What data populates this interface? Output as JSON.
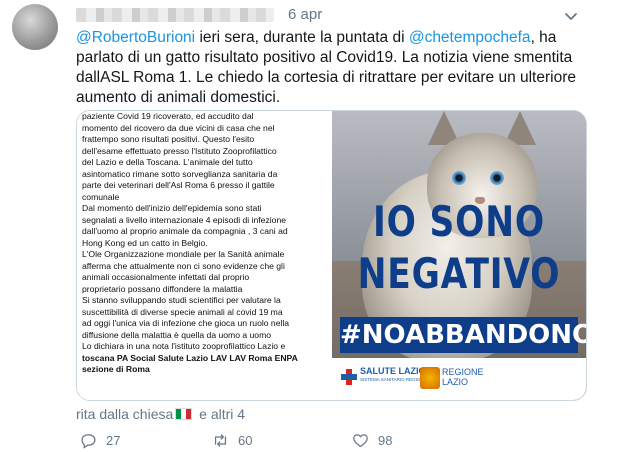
{
  "tweet": {
    "time": "6 apr",
    "text_parts": {
      "mention1": "@RobertoBurioni",
      "text1": " ieri sera, durante la puntata di ",
      "mention2": "@chetempochefa",
      "text2": ", ha parlato di un gatto risultato positivo al Covid19. La notizia viene smentita dallASL Roma 1. Le chiedo la cortesia di ritrattare per evitare un ulteriore aumento di animali domestici."
    },
    "retweet_by": "rita dalla chiesa",
    "retweet_others": " e altri 4",
    "actions": {
      "replies": "27",
      "retweets": "60",
      "likes": "98"
    }
  },
  "media": {
    "document_lines": [
      {
        "text": "paziente Covid 19 ricoverato, ed accudito dal",
        "bold": false
      },
      {
        "text": "momento del ricovero da due vicini di casa che nel",
        "bold": false
      },
      {
        "text": "frattempo sono risultati positivi. Questo l'esito",
        "bold": false
      },
      {
        "text": "dell'esame effettuato presso l'Istituto Zooprofilattico",
        "bold": false
      },
      {
        "text": "del Lazio e della Toscana. L'animale del tutto",
        "bold": false
      },
      {
        "text": "asintomatico rimane sotto sorveglianza sanitaria da",
        "bold": false
      },
      {
        "text": "parte dei veterinari dell'Asl Roma 6 presso il gattile",
        "bold": false
      },
      {
        "text": "comunale",
        "bold": false
      },
      {
        "text": "Dal momento dell'inizio dell'epidemia sono stati",
        "bold": false
      },
      {
        "text": "segnalati a livello internazionale 4 episodi di infezione",
        "bold": false
      },
      {
        "text": "dall'uomo al proprio animale da compagnia , 3 cani ad",
        "bold": false
      },
      {
        "text": "Hong Kong ed un catto in Belgio.",
        "bold": false
      },
      {
        "text": "L'Ole Organizzazione mondiale per la Sanità animale",
        "bold": false
      },
      {
        "text": "afferma che attualmente non ci sono evidenze che gli",
        "bold": false
      },
      {
        "text": "animali occasionalmente infettati dal proprio",
        "bold": false
      },
      {
        "text": "proprietario possano diffondere la malattia",
        "bold": false
      },
      {
        "text": "Si stanno sviluppando studi scientifici per valutare la",
        "bold": false
      },
      {
        "text": "suscettibilità di diverse specie animali al covid 19 ma",
        "bold": false
      },
      {
        "text": "ad oggi l'unica via di infezione che gioca un ruolo nella",
        "bold": false
      },
      {
        "text": "diffusione della malattia è quella da uomo a uomo",
        "bold": false
      },
      {
        "text": "Lo dichiara in una nota l'istituto zooprofilattico Lazio e",
        "bold": false
      },
      {
        "text": "toscana PA Social Salute Lazio LAV LAV Roma ENPA",
        "bold": true
      },
      {
        "text": "sezione di Roma",
        "bold": true
      }
    ],
    "poster": {
      "headline_line1": "IO SONO",
      "headline_line2": "NEGATIVO",
      "hashtag": "#NOABBANDONO",
      "logo1_title": "SALUTE LAZIO",
      "logo1_sub": "SISTEMA SANITARIO REGIONALE",
      "logo2_line1": "REGIONE",
      "logo2_line2": "LAZIO"
    }
  },
  "colors": {
    "link": "#1b95e0",
    "meta": "#657786",
    "poster_blue": "#0e3e8a"
  },
  "icons": [
    "reply-icon",
    "retweet-icon",
    "like-icon",
    "caret-down-icon"
  ]
}
